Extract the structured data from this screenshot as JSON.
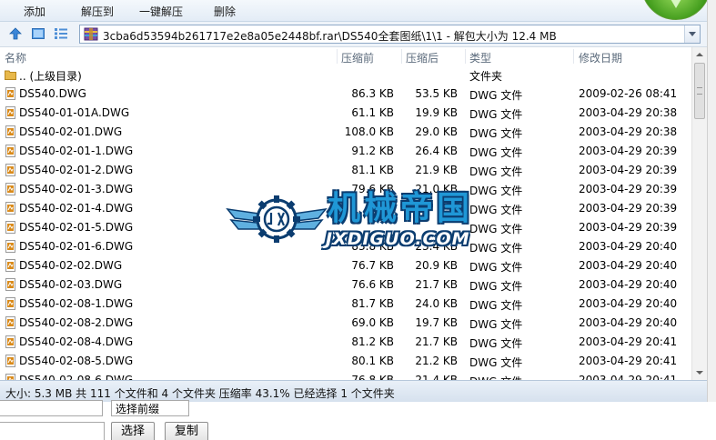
{
  "toolbar": {
    "add": "添加",
    "extract_to": "解压到",
    "one_click_extract": "一键解压",
    "delete": "删除"
  },
  "address": {
    "path": "3cba6d53594b261717e2e8a05e2448bf.rar\\DS540全套图纸\\1\\1 - 解包大小为 12.4 MB"
  },
  "columns": {
    "name": "名称",
    "packed": "压缩前",
    "unpacked": "压缩后",
    "type": "类型",
    "modified": "修改日期"
  },
  "rows": [
    {
      "name": ".. (上级目录)",
      "packed": "",
      "unpacked": "",
      "type": "文件夹",
      "date": "",
      "icon": "folder-icon"
    },
    {
      "name": "DS540.DWG",
      "packed": "86.3 KB",
      "unpacked": "53.5 KB",
      "type": "DWG 文件",
      "date": "2009-02-26 08:41",
      "icon": "dwg-file-icon"
    },
    {
      "name": "DS540-01-01A.DWG",
      "packed": "61.1 KB",
      "unpacked": "19.9 KB",
      "type": "DWG 文件",
      "date": "2003-04-29 20:38",
      "icon": "dwg-file-icon"
    },
    {
      "name": "DS540-02-01.DWG",
      "packed": "108.0 KB",
      "unpacked": "29.0 KB",
      "type": "DWG 文件",
      "date": "2003-04-29 20:38",
      "icon": "dwg-file-icon"
    },
    {
      "name": "DS540-02-01-1.DWG",
      "packed": "91.2 KB",
      "unpacked": "26.4 KB",
      "type": "DWG 文件",
      "date": "2003-04-29 20:39",
      "icon": "dwg-file-icon"
    },
    {
      "name": "DS540-02-01-2.DWG",
      "packed": "81.1 KB",
      "unpacked": "21.9 KB",
      "type": "DWG 文件",
      "date": "2003-04-29 20:39",
      "icon": "dwg-file-icon"
    },
    {
      "name": "DS540-02-01-3.DWG",
      "packed": "79.6 KB",
      "unpacked": "21.0 KB",
      "type": "DWG 文件",
      "date": "2003-04-29 20:39",
      "icon": "dwg-file-icon"
    },
    {
      "name": "DS540-02-01-4.DWG",
      "packed": "",
      "unpacked": "",
      "type": "DWG 文件",
      "date": "2003-04-29 20:39",
      "icon": "dwg-file-icon"
    },
    {
      "name": "DS540-02-01-5.DWG",
      "packed": "",
      "unpacked": "",
      "type": "DWG 文件",
      "date": "2003-04-29 20:39",
      "icon": "dwg-file-icon"
    },
    {
      "name": "DS540-02-01-6.DWG",
      "packed": "83.8 KB",
      "unpacked": "23.4 KB",
      "type": "DWG 文件",
      "date": "2003-04-29 20:40",
      "icon": "dwg-file-icon"
    },
    {
      "name": "DS540-02-02.DWG",
      "packed": "76.7 KB",
      "unpacked": "20.9 KB",
      "type": "DWG 文件",
      "date": "2003-04-29 20:40",
      "icon": "dwg-file-icon"
    },
    {
      "name": "DS540-02-03.DWG",
      "packed": "76.6 KB",
      "unpacked": "21.7 KB",
      "type": "DWG 文件",
      "date": "2003-04-29 20:40",
      "icon": "dwg-file-icon"
    },
    {
      "name": "DS540-02-08-1.DWG",
      "packed": "81.7 KB",
      "unpacked": "24.0 KB",
      "type": "DWG 文件",
      "date": "2003-04-29 20:40",
      "icon": "dwg-file-icon"
    },
    {
      "name": "DS540-02-08-2.DWG",
      "packed": "69.0 KB",
      "unpacked": "19.7 KB",
      "type": "DWG 文件",
      "date": "2003-04-29 20:40",
      "icon": "dwg-file-icon"
    },
    {
      "name": "DS540-02-08-4.DWG",
      "packed": "81.2 KB",
      "unpacked": "21.7 KB",
      "type": "DWG 文件",
      "date": "2003-04-29 20:41",
      "icon": "dwg-file-icon"
    },
    {
      "name": "DS540-02-08-5.DWG",
      "packed": "80.1 KB",
      "unpacked": "21.2 KB",
      "type": "DWG 文件",
      "date": "2003-04-29 20:41",
      "icon": "dwg-file-icon"
    },
    {
      "name": "DS540-02-08-6.DWG",
      "packed": "76.8 KB",
      "unpacked": "21.4 KB",
      "type": "DWG 文件",
      "date": "2003-04-29 20:41",
      "icon": "dwg-file-icon"
    }
  ],
  "status": {
    "text": "大小: 5.3 MB 共 111 个文件和 4 个文件夹 压缩率 43.1% 已经选择 1 个文件夹"
  },
  "form": {
    "prefix_select": "选择前缀",
    "select_button": "选择",
    "copy_button": "复制"
  },
  "watermark": {
    "cn": "机械帝国",
    "en": "JXDIGUO.COM"
  },
  "colors": {
    "watermark_blue": "#1f97d6",
    "watermark_outline": "#0b3d70",
    "folder": "#e8b84a",
    "dwg_icon": "#d98a1a"
  }
}
